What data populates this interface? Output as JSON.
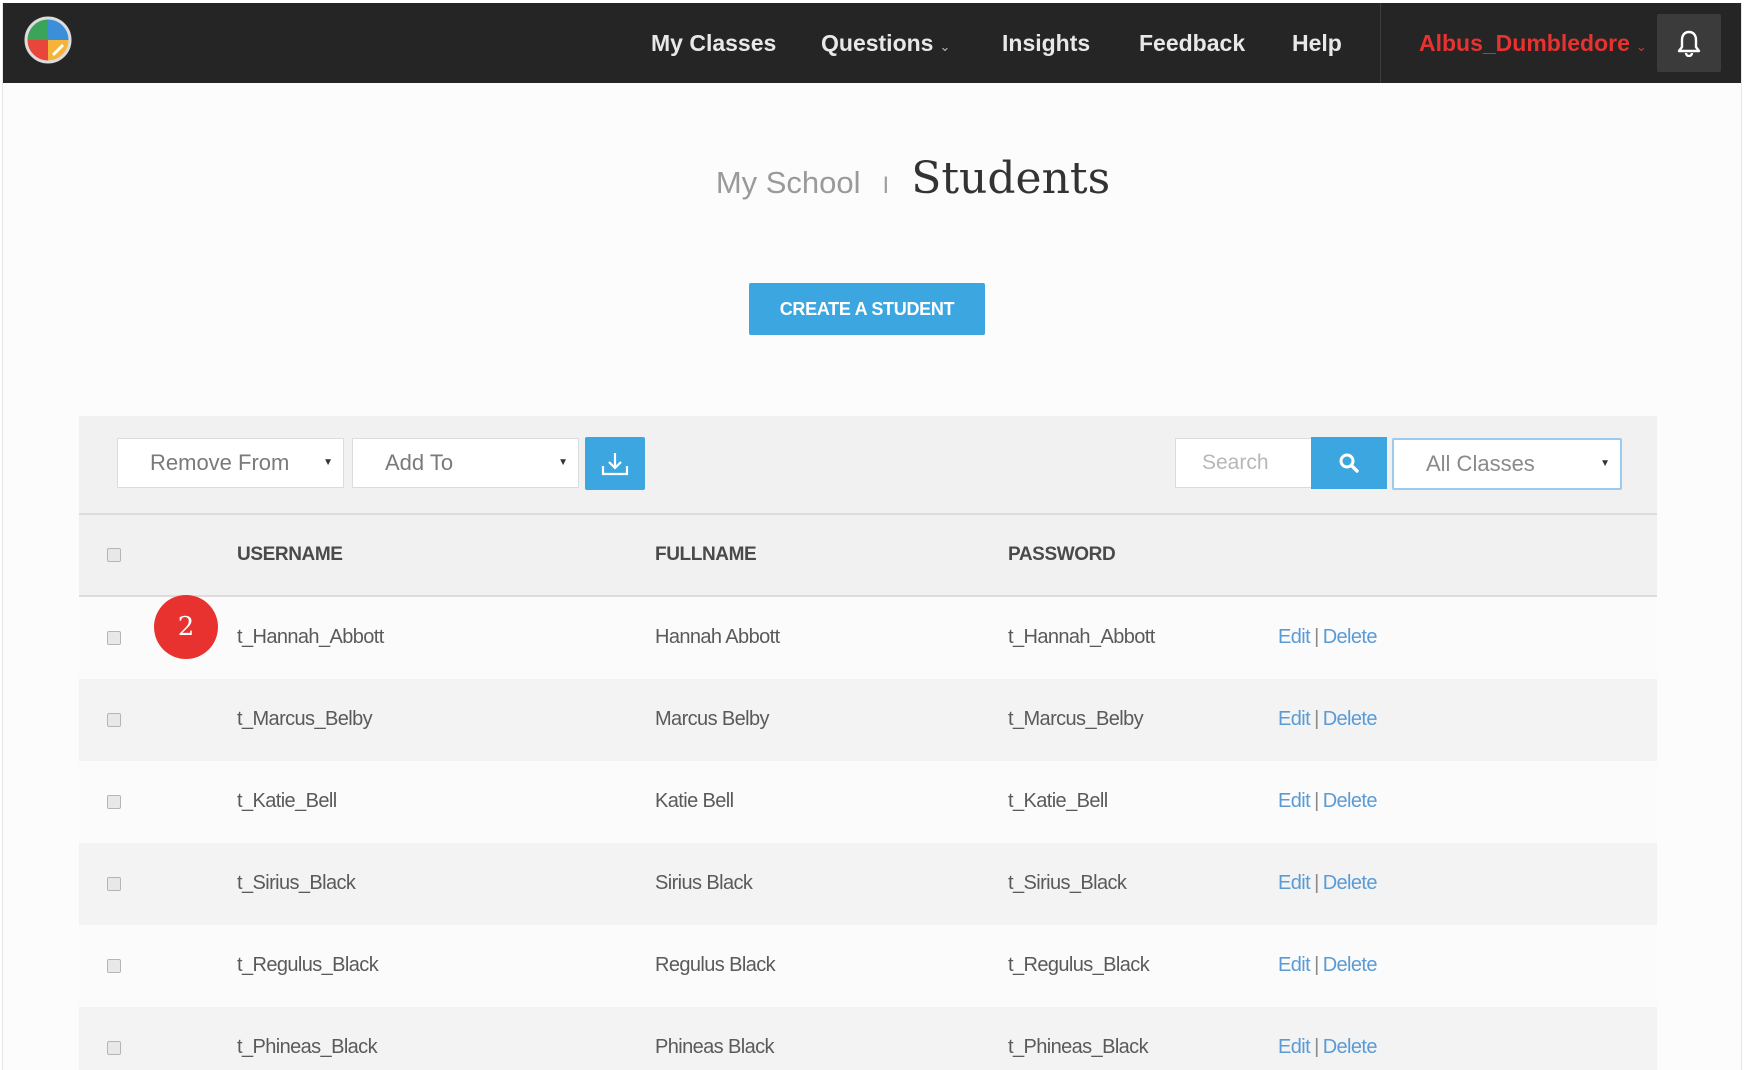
{
  "nav": {
    "items": [
      {
        "label": "My Classes",
        "dropdown": false
      },
      {
        "label": "Questions",
        "dropdown": true
      },
      {
        "label": "Insights",
        "dropdown": false
      },
      {
        "label": "Feedback",
        "dropdown": false
      },
      {
        "label": "Help",
        "dropdown": false
      }
    ],
    "user": "Albus_Dumbledore",
    "caret": "⌄"
  },
  "header": {
    "breadcrumb": "My School",
    "separator": "I",
    "title": "Students"
  },
  "create_button": "CREATE A STUDENT",
  "toolbar": {
    "remove_from": "Remove From",
    "add_to": "Add To",
    "search_placeholder": "Search",
    "class_filter": "All Classes",
    "dd_glyph": "▼"
  },
  "table": {
    "columns": [
      "USERNAME",
      "FULLNAME",
      "PASSWORD",
      ""
    ],
    "rows": [
      {
        "username": "t_Hannah_Abbott",
        "fullname": "Hannah Abbott",
        "password": "t_Hannah_Abbott"
      },
      {
        "username": "t_Marcus_Belby",
        "fullname": "Marcus Belby",
        "password": "t_Marcus_Belby"
      },
      {
        "username": "t_Katie_Bell",
        "fullname": "Katie Bell",
        "password": "t_Katie_Bell"
      },
      {
        "username": "t_Sirius_Black",
        "fullname": "Sirius Black",
        "password": "t_Sirius_Black"
      },
      {
        "username": "t_Regulus_Black",
        "fullname": "Regulus Black",
        "password": "t_Regulus_Black"
      },
      {
        "username": "t_Phineas_Black",
        "fullname": "Phineas Black",
        "password": "t_Phineas_Black"
      }
    ],
    "edit_label": "Edit",
    "delete_label": "Delete",
    "action_separator": "|"
  },
  "step_badge": "2",
  "colors": {
    "accent": "#3ba6e0",
    "topbar": "#252525",
    "user": "#e8322f",
    "badge": "#e8322f"
  }
}
